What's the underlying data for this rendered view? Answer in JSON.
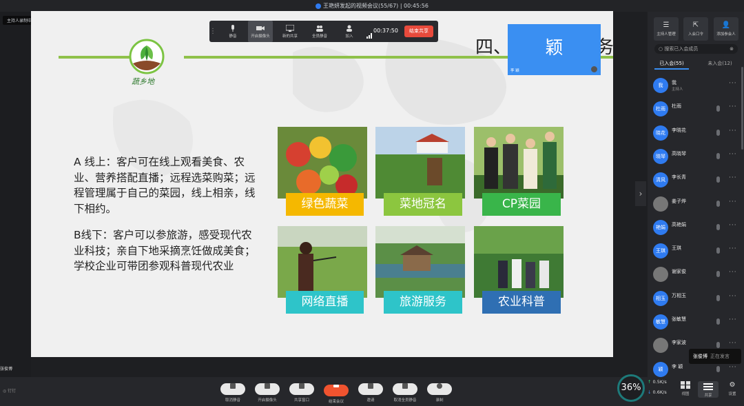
{
  "window": {
    "title": "王艳妍发起的视频会议(55/67) | 00:45:56",
    "host_recording_tag": "主持人录制中"
  },
  "toolbar": {
    "items": [
      "静音",
      "开启摄像头",
      "新的共享",
      "全员静音",
      "加入"
    ],
    "timer": "00:37:50",
    "stop_share": "结束共享"
  },
  "slide": {
    "title_left": "四、",
    "title_right": "务",
    "logo_text": "蔬乡地",
    "para_a": "A 线上：客户可在线上观看美食、农业、营养搭配直播；远程选菜购菜；远程管理属于自己的菜园，线上相亲，线下相约。",
    "para_b": "B线下：客户可以参旅游，感受现代农业科技；亲自下地采摘烹饪做成美食；学校企业可带团参观科普现代农业",
    "tiles": [
      {
        "label": "绿色蔬菜",
        "color": "#f5b800"
      },
      {
        "label": "菜地冠名",
        "color": "#8cc63f"
      },
      {
        "label": "CP菜园",
        "color": "#39b54a"
      },
      {
        "label": "网络直播",
        "color": "#2ec4c9"
      },
      {
        "label": "旅游服务",
        "color": "#2ec4c9"
      },
      {
        "label": "农业科普",
        "color": "#2f6fb3"
      }
    ]
  },
  "video": {
    "name_big": "颖",
    "name_small": "李 颖"
  },
  "panel": {
    "buttons": [
      "主持人管理",
      "入会口令",
      "添加参会人"
    ],
    "search_placeholder": "搜索已入会成员",
    "tab_joined": "已入会(55)",
    "tab_not_joined": "未入会(12)",
    "members": [
      {
        "avatar": "我",
        "name": "我",
        "sub": "主持人"
      },
      {
        "avatar": "杜雨",
        "name": "杜雨",
        "sub": ""
      },
      {
        "avatar": "晓花",
        "name": "李晓花",
        "sub": ""
      },
      {
        "avatar": "晓琴",
        "name": "高晓琴",
        "sub": ""
      },
      {
        "avatar": "清风",
        "name": "李长青",
        "sub": ""
      },
      {
        "avatar": "",
        "name": "姜子烨",
        "sub": ""
      },
      {
        "avatar": "艳娟",
        "name": "高艳娟",
        "sub": ""
      },
      {
        "avatar": "王琪",
        "name": "王琪",
        "sub": ""
      },
      {
        "avatar": "",
        "name": "谢家俊",
        "sub": ""
      },
      {
        "avatar": "相玉",
        "name": "万相玉",
        "sub": ""
      },
      {
        "avatar": "敏慧",
        "name": "张敏慧",
        "sub": ""
      },
      {
        "avatar": "",
        "name": "李家波",
        "sub": ""
      },
      {
        "avatar": "颖",
        "name": "李 颖",
        "sub": ""
      }
    ],
    "tooltip_name": "张俊博",
    "tooltip_status": "正在发言"
  },
  "bottom": {
    "speaker": "张俊博",
    "brand": "钉钉",
    "buttons": [
      "取消静音",
      "开启摄像头",
      "共享窗口",
      "结束会议",
      "邀请",
      "取消全员静音",
      "录制"
    ],
    "gauge": "36%",
    "up_speed": "0.5K/s",
    "down_speed": "0.6K/s",
    "right_buttons": [
      "视图",
      "共享",
      "设置"
    ]
  },
  "colors": {
    "accent": "#3a8ff2",
    "end_red": "#f0532f",
    "slide_green": "#8fc14a"
  }
}
